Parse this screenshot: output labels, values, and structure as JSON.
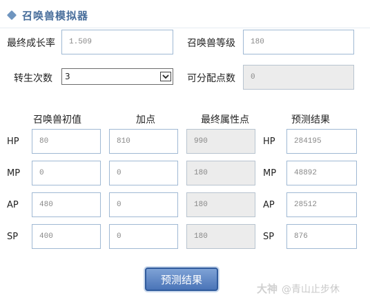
{
  "header": {
    "title": "召唤兽模拟器"
  },
  "settings": {
    "growth_label": "最终成长率",
    "growth_value": "1.509",
    "level_label": "召唤兽等级",
    "level_value": "180",
    "rebirth_label": "转生次数",
    "rebirth_value": "3",
    "points_label": "可分配点数",
    "points_value": "0"
  },
  "columns": {
    "initial": "召唤兽初值",
    "added": "加点",
    "final": "最终属性点",
    "predicted": "预测结果"
  },
  "stats": [
    {
      "name": "HP",
      "initial": "80",
      "added": "810",
      "final": "990",
      "predicted": "284195"
    },
    {
      "name": "MP",
      "initial": "0",
      "added": "0",
      "final": "180",
      "predicted": "48892"
    },
    {
      "name": "AP",
      "initial": "480",
      "added": "0",
      "final": "180",
      "predicted": "28512"
    },
    {
      "name": "SP",
      "initial": "400",
      "added": "0",
      "final": "180",
      "predicted": "876"
    }
  ],
  "actions": {
    "predict_label": "预测结果"
  },
  "watermark": {
    "badge": "大神",
    "text": "@青山止步休"
  }
}
